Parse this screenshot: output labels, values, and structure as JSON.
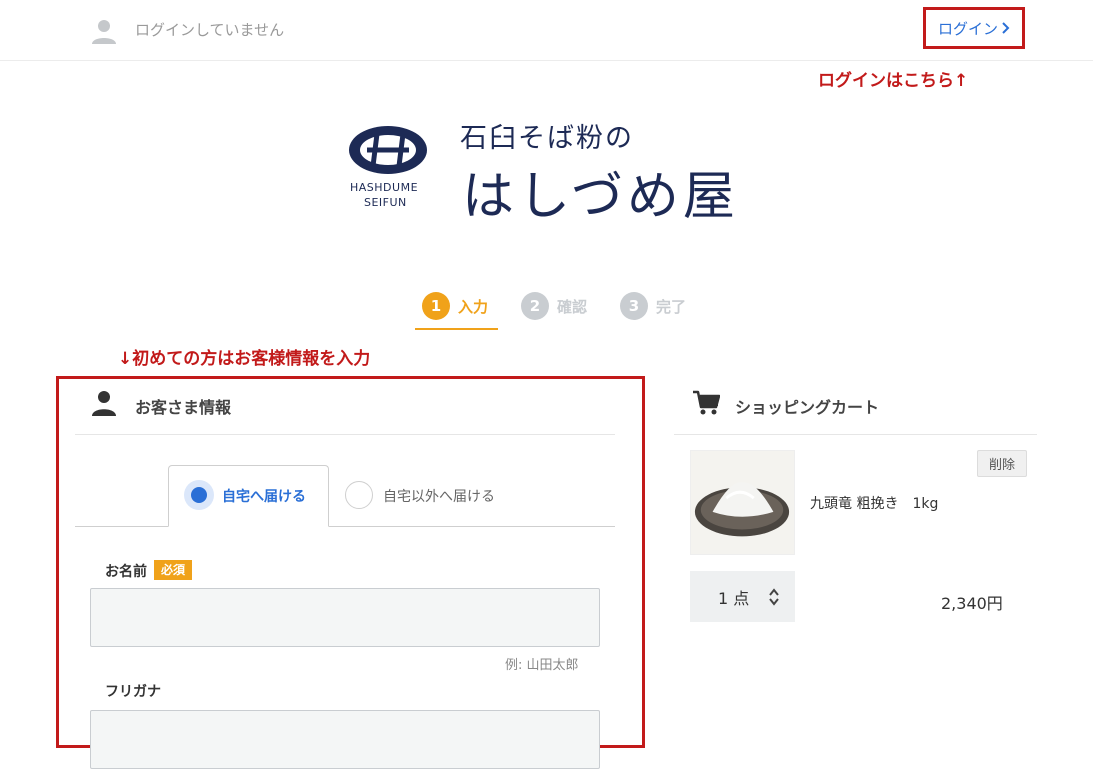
{
  "header": {
    "login_status": "ログインしていません",
    "login_label": "ログイン",
    "login_annotation": "ログインはこちら↑"
  },
  "logo": {
    "en_line1": "HASHDUME",
    "en_line2": "SEIFUN",
    "subtitle": "石臼そば粉の",
    "name": "はしづめ屋"
  },
  "steps": [
    {
      "number": "1",
      "label": "入力",
      "state": "active"
    },
    {
      "number": "2",
      "label": "確認",
      "state": "inactive"
    },
    {
      "number": "3",
      "label": "完了",
      "state": "inactive"
    }
  ],
  "first_time_annotation": "↓初めての方はお客様情報を入力",
  "customer": {
    "title": "お客さま情報",
    "tabs": [
      {
        "label": "自宅へ届ける",
        "selected": true
      },
      {
        "label": "自宅以外へ届ける",
        "selected": false
      }
    ],
    "name_field": {
      "label": "お名前",
      "required_badge": "必須",
      "value": "",
      "hint": "例: 山田太郎"
    },
    "furigana_field": {
      "label": "フリガナ",
      "value": ""
    }
  },
  "cart": {
    "title": "ショッピングカート",
    "items": [
      {
        "name": "九頭竜 粗挽き　1kg",
        "delete_label": "削除",
        "quantity": "1 点",
        "price": "2,340円"
      }
    ]
  },
  "colors": {
    "accent_orange": "#f0a21a",
    "link_blue": "#2a6fd6",
    "annotation_red": "#c21a1a",
    "brand_navy": "#1d2a55"
  }
}
